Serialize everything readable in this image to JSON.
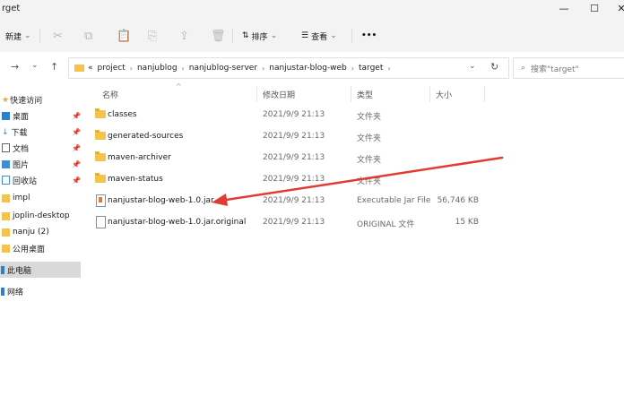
{
  "window": {
    "title": "rget",
    "minimize": "—",
    "maximize": "☐",
    "close": "✕"
  },
  "toolbar": {
    "new_label": "新建",
    "sort_label": "排序",
    "view_label": "查看",
    "more_label": "•••"
  },
  "address": {
    "prefix": "«",
    "crumbs": [
      "project",
      "nanjublog",
      "nanjublog-server",
      "nanjustar-blog-web",
      "target"
    ],
    "search_placeholder": "搜索\"target\""
  },
  "sidebar": {
    "items": [
      {
        "label": "快速访问",
        "icon": "star-icon",
        "pinned": false
      },
      {
        "label": "桌面",
        "icon": "desktop-icon",
        "pinned": true
      },
      {
        "label": "下载",
        "icon": "download-icon",
        "pinned": true
      },
      {
        "label": "文档",
        "icon": "document-icon",
        "pinned": true
      },
      {
        "label": "图片",
        "icon": "picture-icon",
        "pinned": true
      },
      {
        "label": "回收站",
        "icon": "recycle-bin-icon",
        "pinned": true
      },
      {
        "label": "impl",
        "icon": "folder-icon",
        "pinned": false
      },
      {
        "label": "joplin-desktop",
        "icon": "folder-icon",
        "pinned": false
      },
      {
        "label": "nanju (2)",
        "icon": "folder-icon",
        "pinned": false
      },
      {
        "label": "公用桌面",
        "icon": "folder-icon",
        "pinned": false
      },
      {
        "label": "此电脑",
        "icon": "computer-icon",
        "pinned": false
      },
      {
        "label": "网络",
        "icon": "network-icon",
        "pinned": false
      }
    ]
  },
  "columns": {
    "name": "名称",
    "modified": "修改日期",
    "type": "类型",
    "size": "大小"
  },
  "files": [
    {
      "name": "classes",
      "modified": "2021/9/9 21:13",
      "type": "文件夹",
      "size": "",
      "kind": "folder"
    },
    {
      "name": "generated-sources",
      "modified": "2021/9/9 21:13",
      "type": "文件夹",
      "size": "",
      "kind": "folder"
    },
    {
      "name": "maven-archiver",
      "modified": "2021/9/9 21:13",
      "type": "文件夹",
      "size": "",
      "kind": "folder"
    },
    {
      "name": "maven-status",
      "modified": "2021/9/9 21:13",
      "type": "文件夹",
      "size": "",
      "kind": "folder"
    },
    {
      "name": "nanjustar-blog-web-1.0.jar",
      "modified": "2021/9/9 21:13",
      "type": "Executable Jar File",
      "size": "56,746 KB",
      "kind": "jar"
    },
    {
      "name": "nanjustar-blog-web-1.0.jar.original",
      "modified": "2021/9/9 21:13",
      "type": "ORIGINAL 文件",
      "size": "15 KB",
      "kind": "file"
    }
  ],
  "colors": {
    "accent_arrow": "#e03c31",
    "folder": "#f5c24c",
    "selection": "#d9d9d9"
  }
}
